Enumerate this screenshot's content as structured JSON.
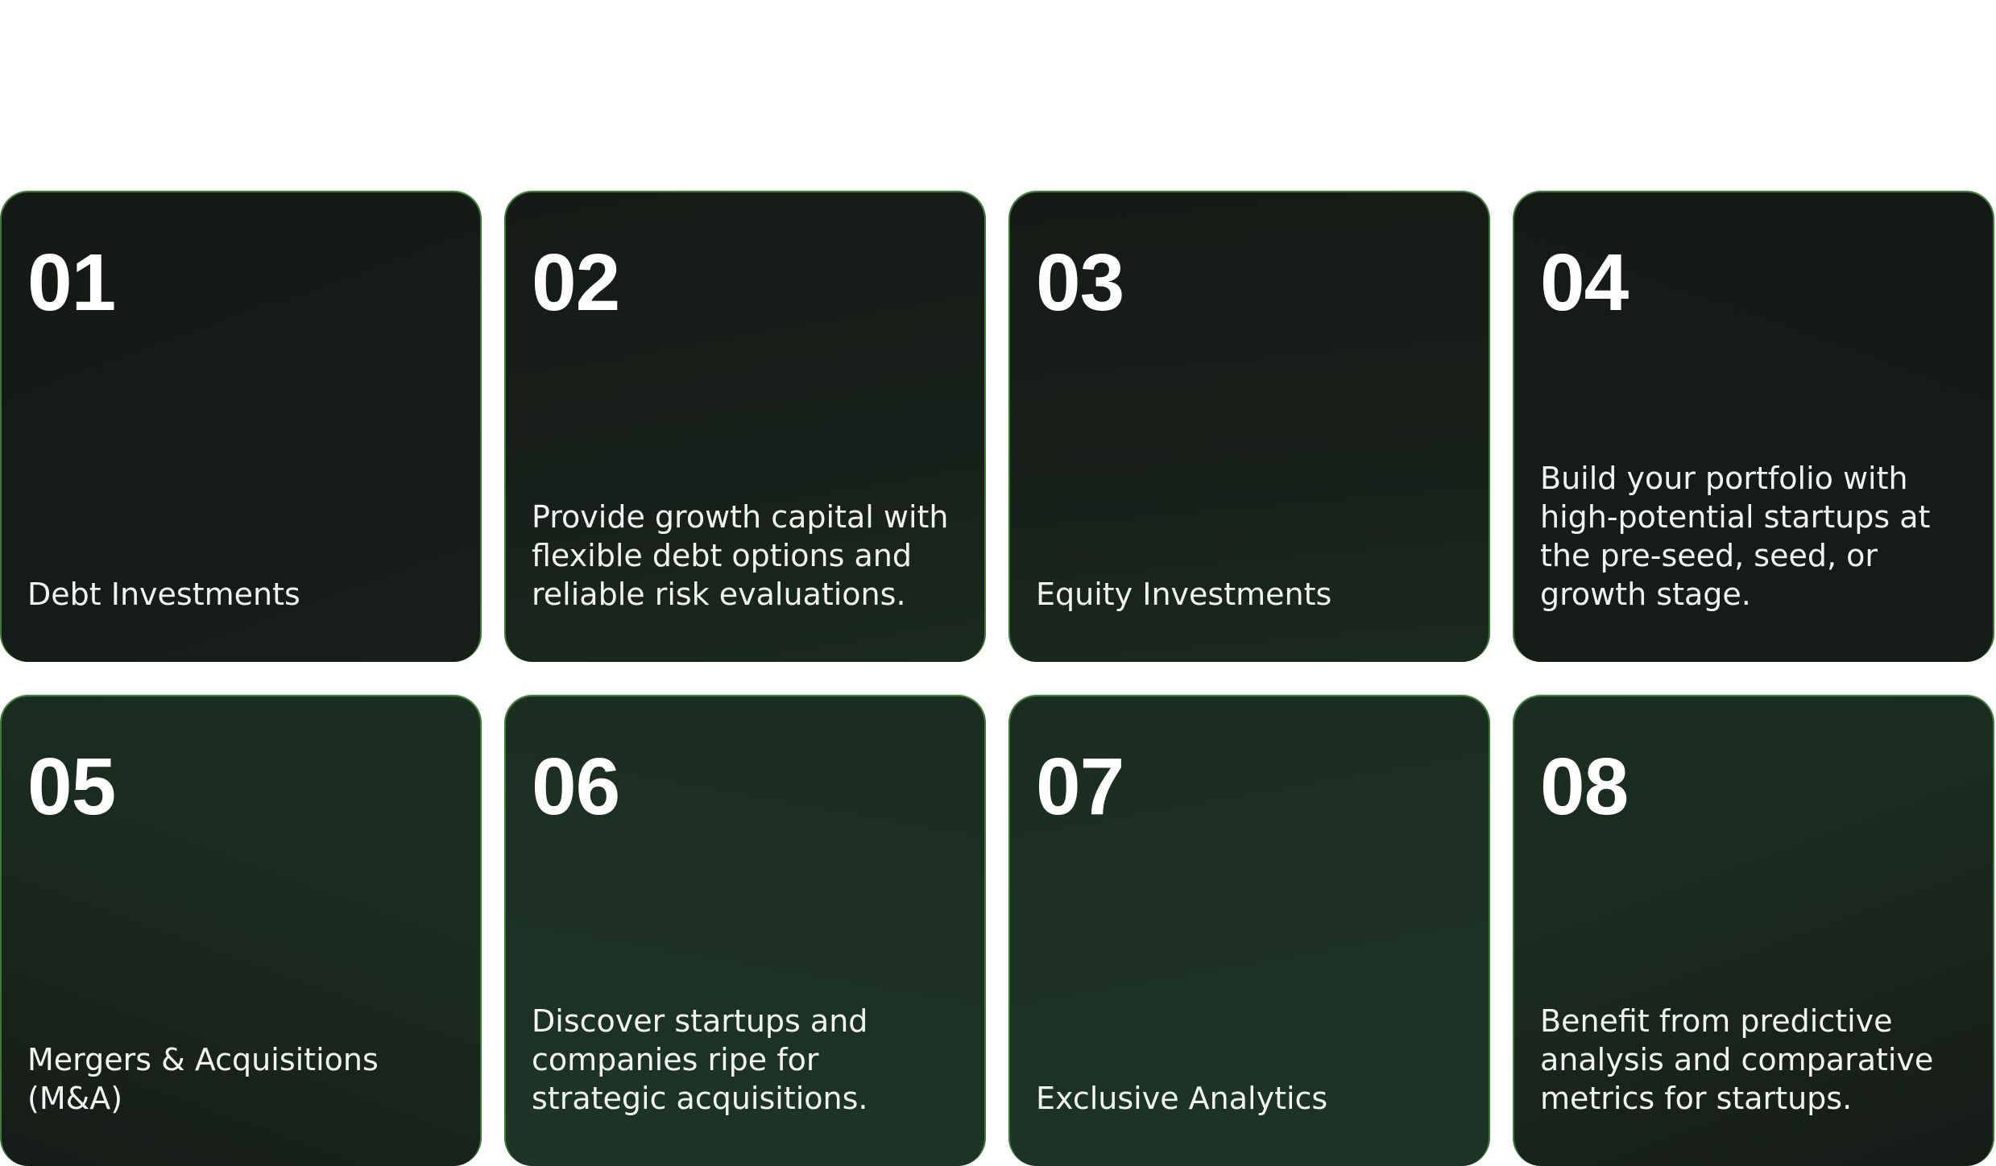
{
  "cards": [
    {
      "number": "01",
      "text": "Debt Investments"
    },
    {
      "number": "02",
      "text": "Provide growth capital with flexible debt options and reliable risk evaluations."
    },
    {
      "number": "03",
      "text": "Equity Investments"
    },
    {
      "number": "04",
      "text": "Build your portfolio with high-potential startups at the pre-seed, seed, or growth stage."
    },
    {
      "number": "05",
      "text": "Mergers & Acquisitions (M&A)"
    },
    {
      "number": "06",
      "text": "Discover startups and companies ripe for strategic acquisitions."
    },
    {
      "number": "07",
      "text": "Exclusive Analytics"
    },
    {
      "number": "08",
      "text": "Benefit from predictive analysis and comparative metrics for startups."
    }
  ],
  "colors": {
    "page_background": "#ffffff",
    "card_dark": "#161a16",
    "card_green": "#1d3426",
    "card_border": "#3d7a3a",
    "text": "#ffffff"
  }
}
